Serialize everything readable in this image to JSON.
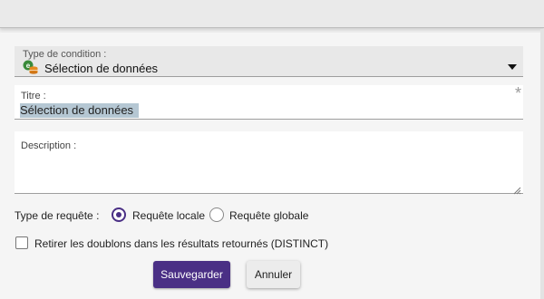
{
  "condition_type": {
    "label": "Type de condition :",
    "value": "Sélection de données",
    "icon": "database-selection-icon"
  },
  "title_field": {
    "label": "Titre :",
    "value": "Sélection de données",
    "required_mark": "*"
  },
  "description_field": {
    "label": "Description :",
    "value": ""
  },
  "request_type": {
    "label": "Type de requête :",
    "options": [
      {
        "label": "Requête locale",
        "selected": true
      },
      {
        "label": "Requête globale",
        "selected": false
      }
    ]
  },
  "distinct_checkbox": {
    "label": "Retirer les doublons dans les résultats retournés (DISTINCT)",
    "checked": false
  },
  "buttons": {
    "save_label": "Sauvegarder",
    "cancel_label": "Annuler"
  },
  "colors": {
    "accent": "#4a2f85",
    "icon_green": "#3a8a3a",
    "icon_orange": "#e58a1f"
  }
}
